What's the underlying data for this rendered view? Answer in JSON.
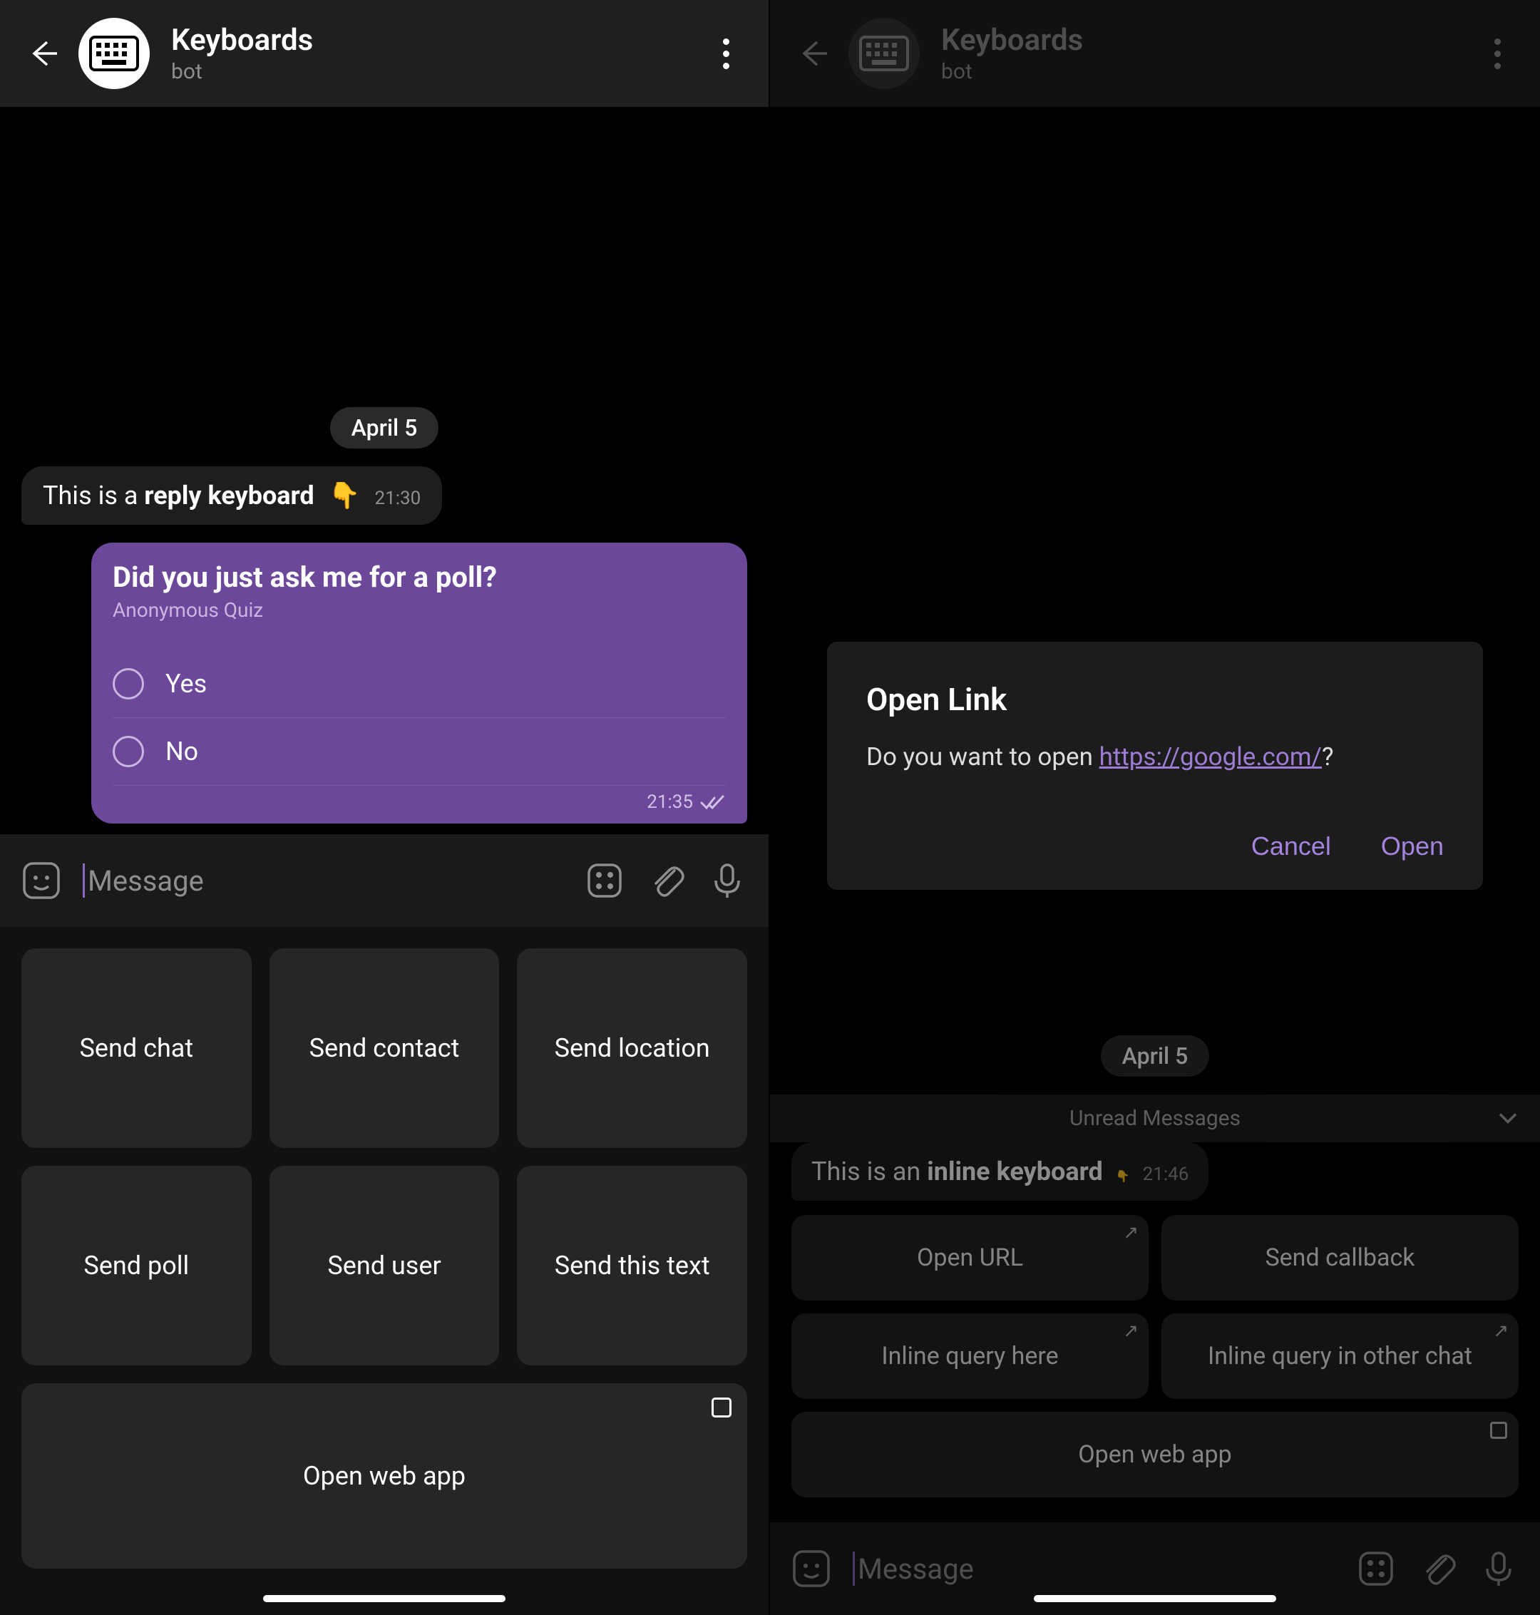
{
  "left": {
    "header": {
      "title": "Keyboards",
      "subtitle": "bot"
    },
    "date": "April 5",
    "msg_in": {
      "prefix": "This is a ",
      "bold": "reply keyboard",
      "emoji": "👇",
      "time": "21:30"
    },
    "poll": {
      "question": "Did you just ask me for a poll?",
      "subtitle": "Anonymous Quiz",
      "options": [
        "Yes",
        "No"
      ],
      "time": "21:35"
    },
    "input_placeholder": "Message",
    "keyboard": {
      "rows": [
        [
          "Send chat",
          "Send contact",
          "Send location"
        ],
        [
          "Send poll",
          "Send user",
          "Send this text"
        ]
      ],
      "full": "Open web app"
    }
  },
  "right": {
    "header": {
      "title": "Keyboards",
      "subtitle": "bot"
    },
    "dialog": {
      "title": "Open Link",
      "prompt_prefix": "Do you want to open ",
      "url": "https://google.com/",
      "prompt_suffix": "?",
      "cancel": "Cancel",
      "open": "Open"
    },
    "date": "April 5",
    "unread": "Unread Messages",
    "msg_in": {
      "prefix": "This is an ",
      "bold": "inline keyboard",
      "emoji": "👇",
      "time": "21:46"
    },
    "inline_kb": {
      "rows": [
        [
          {
            "label": "Open URL",
            "icon": "arrow"
          },
          {
            "label": "Send callback"
          }
        ],
        [
          {
            "label": "Inline query here",
            "icon": "share"
          },
          {
            "label": "Inline query in other chat",
            "icon": "share"
          }
        ]
      ],
      "full": {
        "label": "Open web app",
        "icon": "box"
      }
    },
    "input_placeholder": "Message"
  }
}
